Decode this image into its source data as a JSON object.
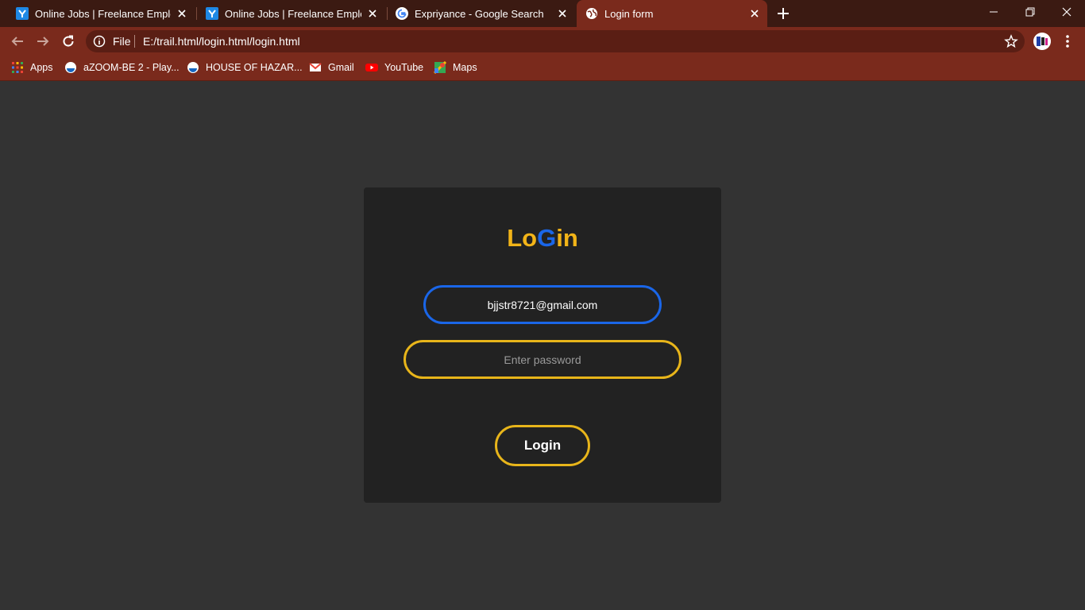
{
  "browser": {
    "tabs": [
      {
        "title": "Online Jobs | Freelance Employment",
        "icon": "upwork-y-icon",
        "active": false
      },
      {
        "title": "Online Jobs | Freelance Employment",
        "icon": "upwork-y-icon",
        "active": false
      },
      {
        "title": "Expriyance - Google Search",
        "icon": "google-icon",
        "active": false
      },
      {
        "title": "Login form",
        "icon": "globe-icon",
        "active": true
      }
    ],
    "address_bar": {
      "scheme_label": "File",
      "url": "E:/trail.html/login.html/login.html"
    },
    "bookmarks": [
      {
        "label": "Apps",
        "icon": "apps-grid-icon"
      },
      {
        "label": "aZOOM-BE 2 - Play...",
        "icon": "play-site-icon"
      },
      {
        "label": "HOUSE OF HAZAR...",
        "icon": "play-site-icon"
      },
      {
        "label": "Gmail",
        "icon": "gmail-icon"
      },
      {
        "label": "YouTube",
        "icon": "youtube-icon"
      },
      {
        "label": "Maps",
        "icon": "maps-icon"
      }
    ],
    "colors": {
      "tabstrip": "#3b1a12",
      "toolbar": "#7a2a1c"
    }
  },
  "login": {
    "title_part1": "Lo",
    "title_part2": "G",
    "title_part3": "in",
    "email_value": "bjjstr8721@gmail.com",
    "password_placeholder": "Enter password",
    "button_label": "Login",
    "colors": {
      "accent_yellow": "#e8b51a",
      "accent_blue": "#1a66e8",
      "card": "#222222",
      "page": "#333333"
    }
  }
}
